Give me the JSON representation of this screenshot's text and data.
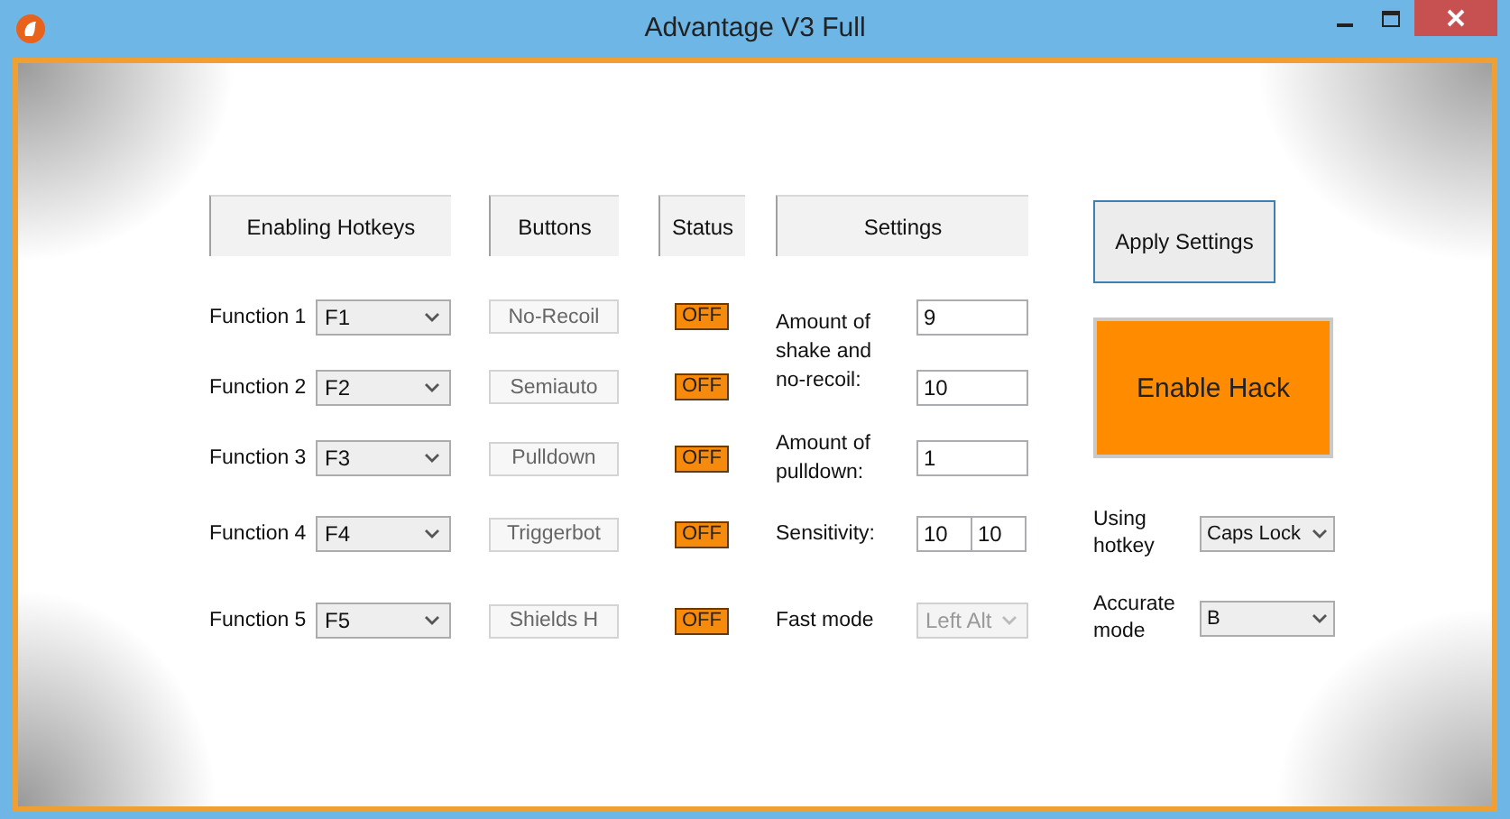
{
  "window": {
    "title": "Advantage V3 Full"
  },
  "column_headers": [
    "Enabling Hotkeys",
    "Buttons",
    "Status",
    "Settings"
  ],
  "functions": [
    {
      "label": "Function 1",
      "hotkey": "F1",
      "button": "No-Recoil",
      "status": "OFF"
    },
    {
      "label": "Function 2",
      "hotkey": "F2",
      "button": "Semiauto",
      "status": "OFF"
    },
    {
      "label": "Function 3",
      "hotkey": "F3",
      "button": "Pulldown",
      "status": "OFF"
    },
    {
      "label": "Function 4",
      "hotkey": "F4",
      "button": "Triggerbot",
      "status": "OFF"
    },
    {
      "label": "Function 5",
      "hotkey": "F5",
      "button": "Shields H",
      "status": "OFF"
    }
  ],
  "settings": [
    {
      "kind": "stacked",
      "label": "Amount of shake and no-recoil:",
      "values": [
        "9",
        "10"
      ]
    },
    {
      "kind": "single",
      "label": "Amount of pulldown:",
      "values": [
        "1"
      ]
    },
    {
      "kind": "split",
      "label": "Sensitivity:",
      "values": [
        "10",
        "10"
      ]
    },
    {
      "kind": "dropdown",
      "label": "Fast mode",
      "values": [
        "Left Alt"
      ],
      "disabled": true
    }
  ],
  "apply_button": "Apply Settings",
  "enable_button": "Enable Hack",
  "options": [
    {
      "label": "Using hotkey",
      "value": "Caps Lock"
    },
    {
      "label": "Accurate mode",
      "value": "B"
    }
  ]
}
